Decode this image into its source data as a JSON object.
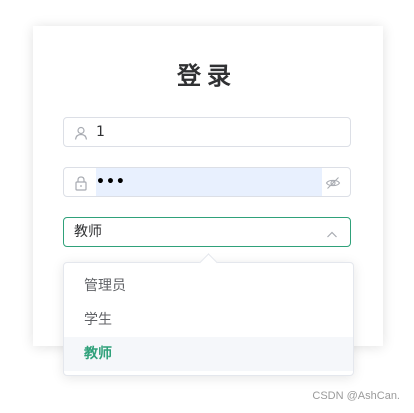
{
  "login": {
    "title": "登录"
  },
  "username_field": {
    "value": "1",
    "icon": "user-icon"
  },
  "password_field": {
    "value": "•••",
    "prefix_icon": "lock-icon",
    "suffix_icon": "eye-hidden-icon"
  },
  "role_select": {
    "value": "教师",
    "icon": "chevron-up-icon"
  },
  "role_dropdown": {
    "options": [
      "管理员",
      "学生",
      "教师"
    ],
    "selected_index": 2
  },
  "watermark": "CSDN @AshCan.",
  "colors": {
    "accent": "#2fa17a",
    "autofill": "#e8f0fe",
    "border": "#dcdfe6",
    "text": "#303133"
  }
}
